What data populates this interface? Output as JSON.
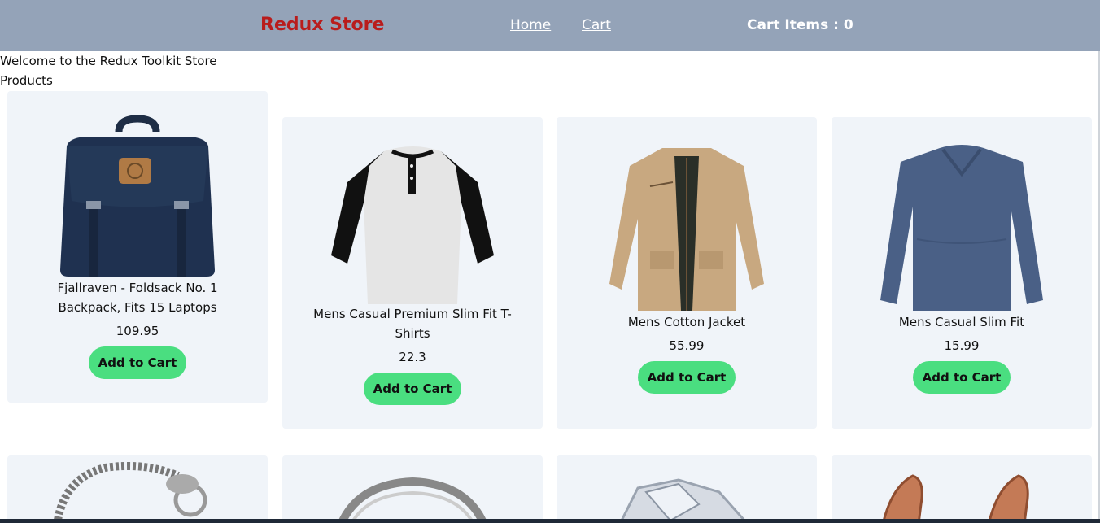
{
  "header": {
    "brand": "Redux Store",
    "nav": {
      "home": "Home",
      "cart": "Cart"
    },
    "cart_items": "Cart Items : 0"
  },
  "welcome_text": "Welcome to the Redux Toolkit Store",
  "products_label": "Products",
  "products": [
    {
      "title": "Fjallraven - Foldsack No. 1 Backpack, Fits 15 Laptops",
      "price": "109.95",
      "button": "Add to Cart",
      "image_icon": "backpack-icon"
    },
    {
      "title": "Mens Casual Premium Slim Fit T-Shirts",
      "price": "22.3",
      "button": "Add to Cart",
      "image_icon": "tshirt-icon"
    },
    {
      "title": "Mens Cotton Jacket",
      "price": "55.99",
      "button": "Add to Cart",
      "image_icon": "jacket-icon"
    },
    {
      "title": "Mens Casual Slim Fit",
      "price": "15.99",
      "button": "Add to Cart",
      "image_icon": "sweater-icon"
    }
  ],
  "next_row_images": [
    "bracelet-icon",
    "ring-icon",
    "diamond-ring-icon",
    "earrings-icon"
  ],
  "colors": {
    "navbar_bg": "#94a3b8",
    "brand": "#b91c1c",
    "button": "#4ade80",
    "card_bg": "#f0f4f9"
  }
}
